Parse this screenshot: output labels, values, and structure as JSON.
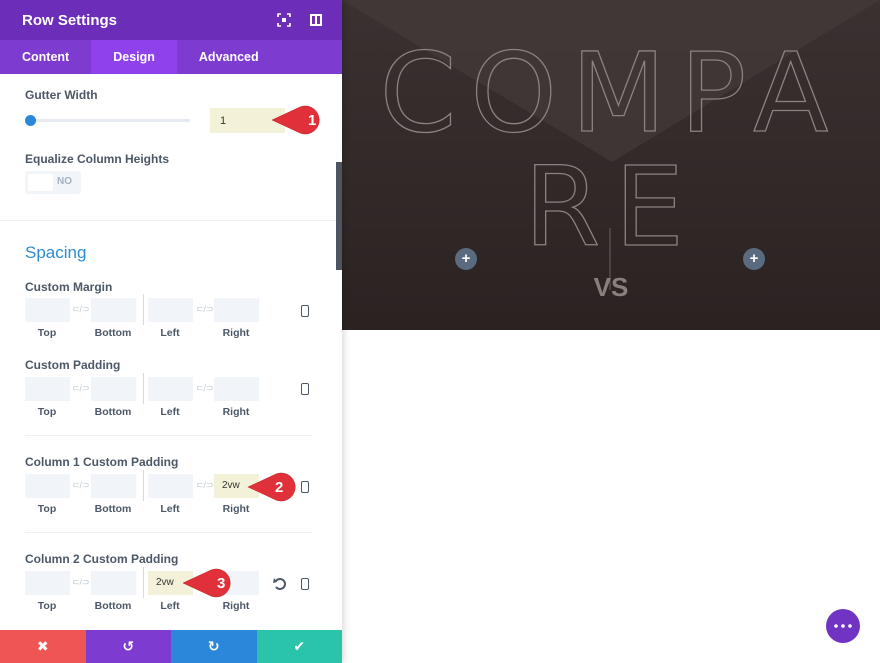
{
  "panel": {
    "title": "Row Settings",
    "header_icons": [
      "fullscreen-icon",
      "sidebar-layout-icon"
    ],
    "tabs": [
      {
        "label": "Content",
        "active": false
      },
      {
        "label": "Design",
        "active": true
      },
      {
        "label": "Advanced",
        "active": false
      }
    ],
    "gutter": {
      "label": "Gutter Width",
      "value": "1",
      "slider_fraction": 0
    },
    "equalize": {
      "label": "Equalize Column Heights",
      "toggle_text": "NO"
    },
    "spacing": {
      "title": "Spacing",
      "captions": {
        "top": "Top",
        "bottom": "Bottom",
        "left": "Left",
        "right": "Right"
      },
      "custom_margin": {
        "label": "Custom Margin",
        "top": "",
        "bottom": "",
        "left": "",
        "right": ""
      },
      "custom_padding": {
        "label": "Custom Padding",
        "top": "",
        "bottom": "",
        "left": "",
        "right": ""
      },
      "col1_padding": {
        "label": "Column 1 Custom Padding",
        "top": "",
        "bottom": "",
        "left": "",
        "right": "2vw"
      },
      "col2_padding": {
        "label": "Column 2 Custom Padding",
        "top": "",
        "bottom": "",
        "left": "2vw",
        "right": ""
      }
    },
    "link_glyph": "⊂/⊃",
    "markers": [
      "1",
      "2",
      "3"
    ],
    "footer": {
      "cancel": "✖",
      "undo": "↺",
      "redo": "↻",
      "save": "✔"
    }
  },
  "preview": {
    "heading_line1": "COMPA",
    "heading_line2": "RE",
    "subheading": "VS",
    "add_glyph": "+"
  },
  "colors": {
    "header": "#6c2eb9",
    "tabs": "#7e3bd0",
    "tab_active": "#8f42ec",
    "cancel": "#ef5555",
    "undo": "#7e3bd0",
    "redo": "#2b87da",
    "save": "#29c4a9",
    "marker": "#e0313a",
    "section_title": "#2e8ccd"
  }
}
